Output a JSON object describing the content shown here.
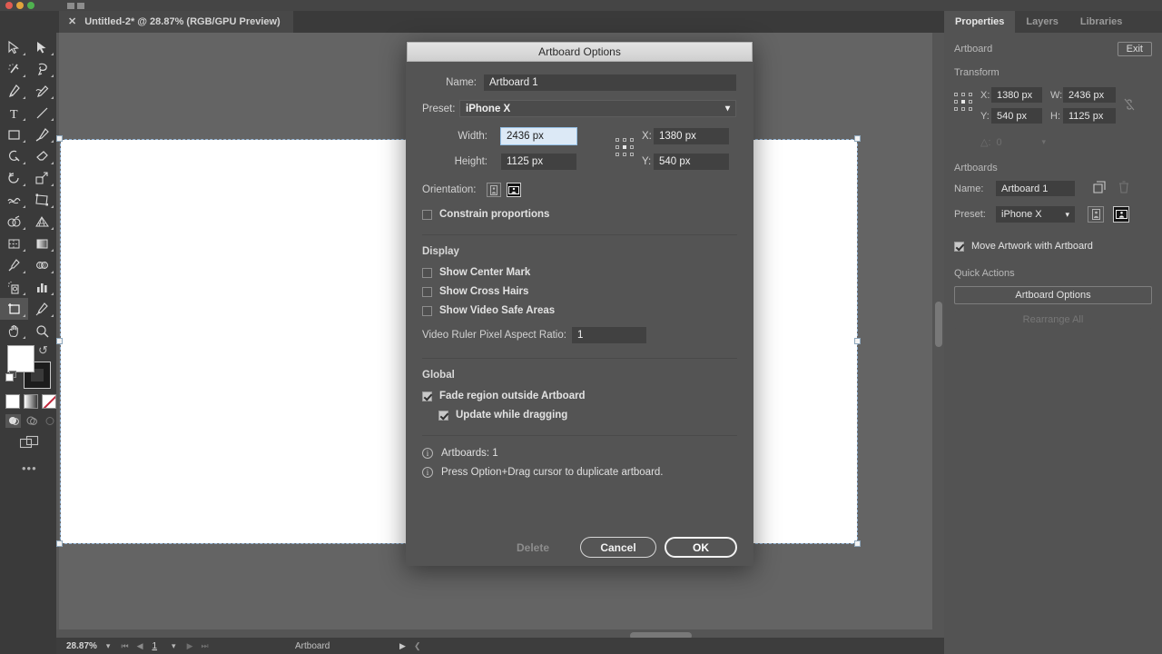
{
  "window": {
    "traffic_lights": [
      "close",
      "minimize",
      "zoom"
    ]
  },
  "document_tab": {
    "close_icon": "close-icon",
    "title": "Untitled-2* @ 28.87% (RGB/GPU Preview)"
  },
  "toolbar": {
    "tools": [
      {
        "name": "selection-tool",
        "glyph": "arrow-outline"
      },
      {
        "name": "direct-selection-tool",
        "glyph": "arrow-filled"
      },
      {
        "name": "magic-wand-tool",
        "glyph": "wand"
      },
      {
        "name": "lasso-tool",
        "glyph": "lasso"
      },
      {
        "name": "pen-tool",
        "glyph": "pen"
      },
      {
        "name": "curvature-tool",
        "glyph": "curvature"
      },
      {
        "name": "type-tool",
        "glyph": "T"
      },
      {
        "name": "line-segment-tool",
        "glyph": "line"
      },
      {
        "name": "rectangle-tool",
        "glyph": "rectangle"
      },
      {
        "name": "paintbrush-tool",
        "glyph": "brush"
      },
      {
        "name": "shaper-tool",
        "glyph": "shaper"
      },
      {
        "name": "eraser-tool",
        "glyph": "eraser"
      },
      {
        "name": "rotate-tool",
        "glyph": "rotate"
      },
      {
        "name": "scale-tool",
        "glyph": "scale"
      },
      {
        "name": "width-tool",
        "glyph": "width"
      },
      {
        "name": "free-transform-tool",
        "glyph": "free-transform"
      },
      {
        "name": "shape-builder-tool",
        "glyph": "shape-builder"
      },
      {
        "name": "perspective-grid-tool",
        "glyph": "perspective"
      },
      {
        "name": "mesh-tool",
        "glyph": "mesh"
      },
      {
        "name": "gradient-tool",
        "glyph": "gradient"
      },
      {
        "name": "eyedropper-tool",
        "glyph": "eyedropper"
      },
      {
        "name": "blend-tool",
        "glyph": "blend"
      },
      {
        "name": "symbol-sprayer-tool",
        "glyph": "symbol-sprayer"
      },
      {
        "name": "column-graph-tool",
        "glyph": "bar-chart"
      },
      {
        "name": "artboard-tool",
        "glyph": "artboard",
        "selected": true
      },
      {
        "name": "slice-tool",
        "glyph": "slice"
      },
      {
        "name": "hand-tool",
        "glyph": "hand"
      },
      {
        "name": "zoom-tool",
        "glyph": "magnifier"
      }
    ],
    "fill_color": "#ffffff",
    "stroke_color": "#000000",
    "paint_modes": [
      "solid-color",
      "gradient",
      "none"
    ],
    "draw_modes": [
      "draw-normal",
      "draw-behind",
      "draw-inside"
    ],
    "more_tools_label": "•••"
  },
  "canvas": {
    "artboard_fill": "#ffffff",
    "background": "#646464",
    "selection_color": "#93b4d6"
  },
  "statusbar": {
    "zoom": "28.87%",
    "page": "1",
    "label": "Artboard"
  },
  "properties_panel": {
    "tabs": [
      {
        "label": "Properties",
        "active": true
      },
      {
        "label": "Layers",
        "active": false
      },
      {
        "label": "Libraries",
        "active": false
      }
    ],
    "header": {
      "title": "Artboard",
      "exit_label": "Exit"
    },
    "transform": {
      "title": "Transform",
      "x_label": "X:",
      "x_value": "1380 px",
      "y_label": "Y:",
      "y_value": "540 px",
      "w_label": "W:",
      "w_value": "2436 px",
      "h_label": "H:",
      "h_value": "1125 px",
      "angle_label": "△:",
      "angle_value": "0",
      "link_icon": "broken-link-icon"
    },
    "artboards": {
      "title": "Artboards",
      "name_label": "Name:",
      "name_value": "Artboard 1",
      "preset_label": "Preset:",
      "preset_value": "iPhone X",
      "new_artboard_icon": "new-artboard-icon",
      "delete_artboard_icon": "trash-icon",
      "orientation_portrait_icon": "portrait-icon",
      "orientation_landscape_icon": "landscape-icon",
      "move_artwork_label": "Move Artwork with Artboard",
      "move_artwork_checked": true
    },
    "quick_actions": {
      "title": "Quick Actions",
      "artboard_options_label": "Artboard Options",
      "rearrange_all_label": "Rearrange All",
      "rearrange_all_disabled": true
    }
  },
  "dialog": {
    "title": "Artboard Options",
    "name_label": "Name:",
    "name_value": "Artboard 1",
    "preset_label": "Preset:",
    "preset_value": "iPhone X",
    "width_label": "Width:",
    "width_value": "2436 px",
    "width_focused": true,
    "height_label": "Height:",
    "height_value": "1125 px",
    "x_label": "X:",
    "x_value": "1380 px",
    "y_label": "Y:",
    "y_value": "540 px",
    "orientation_label": "Orientation:",
    "orientation_portrait_icon": "portrait-icon",
    "orientation_landscape_icon": "landscape-icon",
    "orientation_selected": "landscape",
    "constrain_label": "Constrain proportions",
    "constrain_checked": false,
    "display_section": "Display",
    "show_center_mark_label": "Show Center Mark",
    "show_center_mark_checked": false,
    "show_cross_hairs_label": "Show Cross Hairs",
    "show_cross_hairs_checked": false,
    "show_video_safe_label": "Show Video Safe Areas",
    "show_video_safe_checked": false,
    "video_ratio_label": "Video Ruler Pixel Aspect Ratio:",
    "video_ratio_value": "1",
    "global_section": "Global",
    "fade_region_label": "Fade region outside Artboard",
    "fade_region_checked": true,
    "update_dragging_label": "Update while dragging",
    "update_dragging_checked": true,
    "info_artboards": "Artboards: 1",
    "info_hint": "Press Option+Drag cursor to duplicate artboard.",
    "delete_label": "Delete",
    "delete_disabled": true,
    "cancel_label": "Cancel",
    "ok_label": "OK"
  }
}
